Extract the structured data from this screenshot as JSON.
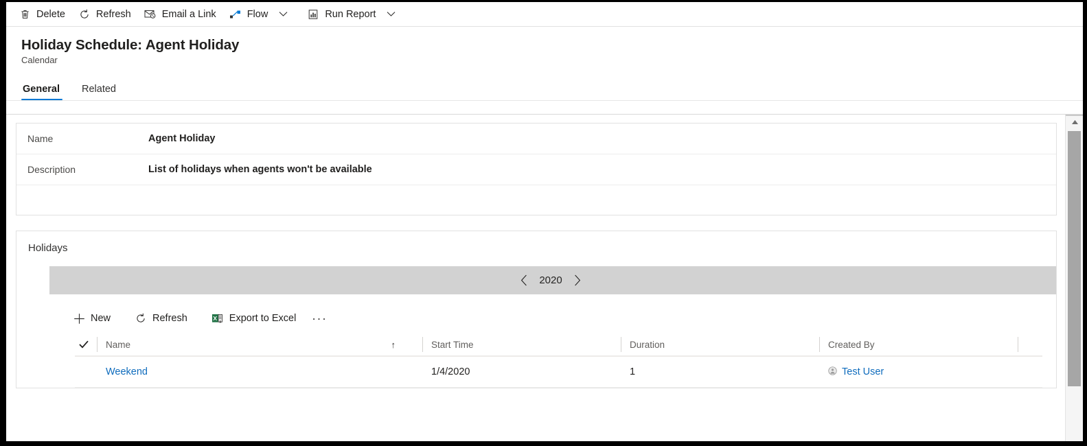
{
  "commandbar": {
    "items": [
      {
        "label": "Delete",
        "icon": "trash-icon",
        "has_chevron": false
      },
      {
        "label": "Refresh",
        "icon": "refresh-icon",
        "has_chevron": false
      },
      {
        "label": "Email a Link",
        "icon": "email-link-icon",
        "has_chevron": false
      },
      {
        "label": "Flow",
        "icon": "flow-icon",
        "has_chevron": true
      },
      {
        "label": "Run Report",
        "icon": "report-icon",
        "has_chevron": true
      }
    ]
  },
  "header": {
    "title": "Holiday Schedule: Agent Holiday",
    "subtitle": "Calendar"
  },
  "tabs": [
    {
      "label": "General",
      "active": true
    },
    {
      "label": "Related",
      "active": false
    }
  ],
  "general": {
    "fields": [
      {
        "label": "Name",
        "value": "Agent Holiday"
      },
      {
        "label": "Description",
        "value": "List of holidays when agents won't be available"
      }
    ]
  },
  "holidays": {
    "section_title": "Holidays",
    "year_nav": {
      "prev_icon": "chevron-left-icon",
      "next_icon": "chevron-right-icon",
      "year": "2020"
    },
    "subgrid_commands": [
      {
        "label": "New",
        "icon": "plus-icon"
      },
      {
        "label": "Refresh",
        "icon": "refresh-icon"
      },
      {
        "label": "Export to Excel",
        "icon": "excel-icon"
      }
    ],
    "overflow_label": "···",
    "grid": {
      "select_all_icon": "checkmark-icon",
      "sort_indicator": "↑",
      "columns": [
        "Name",
        "Start Time",
        "Duration",
        "Created By"
      ],
      "rows": [
        {
          "name": "Weekend",
          "start_time": "1/4/2020",
          "duration": "1",
          "created_by": "Test User",
          "created_by_icon": "user-avatar-icon"
        }
      ]
    }
  },
  "scrollbar": {
    "up_icon": "scroll-up-arrow",
    "down_icon": "scroll-down-arrow"
  },
  "colors": {
    "accent": "#0078d4",
    "link": "#0f6cbd",
    "year_bar": "#d2d2d2",
    "border": "#e1e1e1"
  }
}
